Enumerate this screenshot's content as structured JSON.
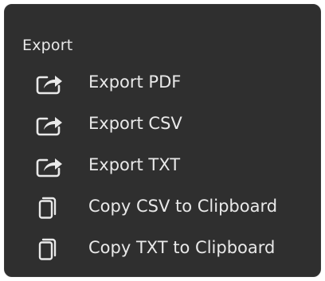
{
  "menu": {
    "title": "Export",
    "items": [
      {
        "label": "Export PDF",
        "icon": "share-icon"
      },
      {
        "label": "Export CSV",
        "icon": "share-icon"
      },
      {
        "label": "Export TXT",
        "icon": "share-icon"
      },
      {
        "label": "Copy CSV to Clipboard",
        "icon": "copy-icon"
      },
      {
        "label": "Copy TXT to Clipboard",
        "icon": "copy-icon"
      }
    ]
  },
  "colors": {
    "background": "#2f2f2f",
    "text": "#e9e9e9"
  }
}
